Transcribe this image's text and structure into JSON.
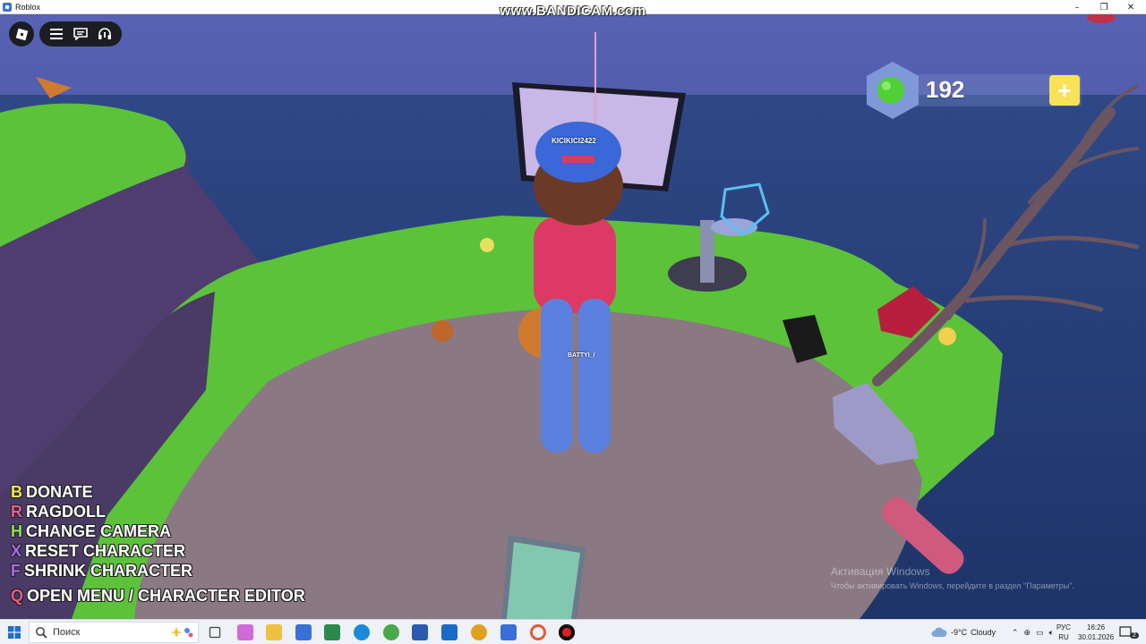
{
  "window": {
    "title": "Roblox",
    "minimize": "–",
    "maximize": "❐",
    "close": "✕"
  },
  "watermark": "www.BANDICAM.com",
  "roblox_menu": {
    "icons": [
      "roblox-logo-icon",
      "hamburger-menu-icon",
      "chat-icon",
      "headset-icon"
    ]
  },
  "currency": {
    "count": "192",
    "add_label": "+",
    "icon": "green-gem-icon"
  },
  "player_tags": {
    "main": "KICIKICI2422",
    "other": "BATTYI_/"
  },
  "keybinds": [
    {
      "key": "B",
      "label": "DONATE",
      "color": "#f5e84a"
    },
    {
      "key": "R",
      "label": "RAGDOLL",
      "color": "#e85a9a"
    },
    {
      "key": "H",
      "label": "CHANGE CAMERA",
      "color": "#8fe05a"
    },
    {
      "key": "X",
      "label": "RESET CHARACTER",
      "color": "#a66ae8"
    },
    {
      "key": "F",
      "label": "SHRINK CHARACTER",
      "color": "#b06ae8"
    },
    {
      "key": "Q",
      "label": "OPEN MENU / CHARACTER EDITOR",
      "color": "#e85a8a"
    }
  ],
  "activation": {
    "title": "Активация Windows",
    "subtitle": "Чтобы активировать Windows, перейдите в раздел \"Параметры\"."
  },
  "taskbar": {
    "search_placeholder": "Поиск",
    "apps": [
      "task-view-icon",
      "copilot-icon",
      "file-explorer-icon",
      "store-icon",
      "excel-icon",
      "edge-icon",
      "utorrent-icon",
      "word-icon",
      "outlook-icon",
      "chrome-icon",
      "roblox-icon",
      "opera-icon",
      "bandicam-record-icon"
    ],
    "weather": {
      "temp": "-9°C",
      "condition": "Cloudy"
    },
    "language_top": "РУС",
    "language_bottom": "RU",
    "time": "16:26",
    "date": "30.01.2026",
    "notifications": "2"
  },
  "colors": {
    "sky": "#4a55a8",
    "grass": "#5cc23a",
    "dirt": "#8a7882",
    "gem": "#4fd136",
    "plus_button": "#f7e25a"
  }
}
